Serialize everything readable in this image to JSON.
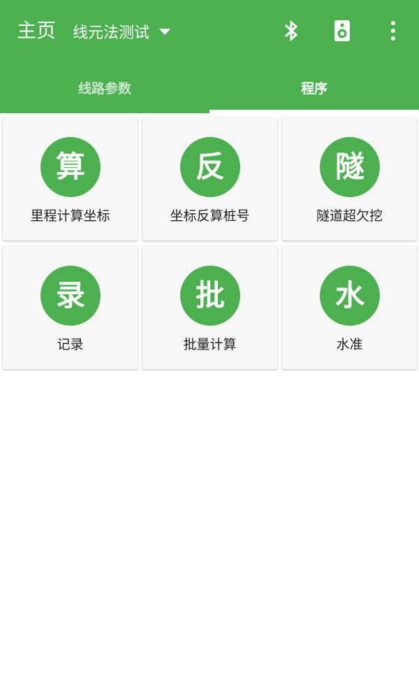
{
  "colors": {
    "primary": "#4caf50",
    "card_background": "#f7f7f7",
    "tab_inactive_text": "#c8e6c9",
    "tab_active_text": "#ffffff"
  },
  "toolbar": {
    "title": "主页",
    "spinner": {
      "selected": "线元法测试"
    },
    "actions": [
      {
        "icon": "bluetooth-icon"
      },
      {
        "icon": "speaker-icon"
      },
      {
        "icon": "more-vert-icon"
      }
    ]
  },
  "tabs": [
    {
      "label": "线路参数",
      "active": false
    },
    {
      "label": "程序",
      "active": true
    }
  ],
  "programs": [
    {
      "glyph": "算",
      "label": "里程计算坐标"
    },
    {
      "glyph": "反",
      "label": "坐标反算桩号"
    },
    {
      "glyph": "隧",
      "label": "隧道超欠挖"
    },
    {
      "glyph": "录",
      "label": "记录"
    },
    {
      "glyph": "批",
      "label": "批量计算"
    },
    {
      "glyph": "水",
      "label": "水准"
    }
  ]
}
